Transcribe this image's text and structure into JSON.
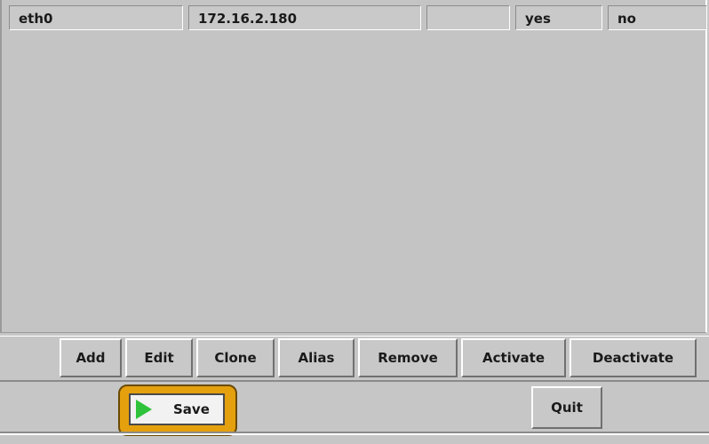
{
  "list": {
    "rows": [
      {
        "device": "eth0",
        "ip": "172.16.2.180",
        "extra": "",
        "onboot": "yes",
        "active": "no"
      }
    ]
  },
  "buttons": {
    "add": "Add",
    "edit": "Edit",
    "clone": "Clone",
    "alias": "Alias",
    "remove": "Remove",
    "activate": "Activate",
    "deactivate": "Deactivate"
  },
  "bottom": {
    "save": "Save",
    "quit": "Quit",
    "save_icon": "play-icon"
  }
}
